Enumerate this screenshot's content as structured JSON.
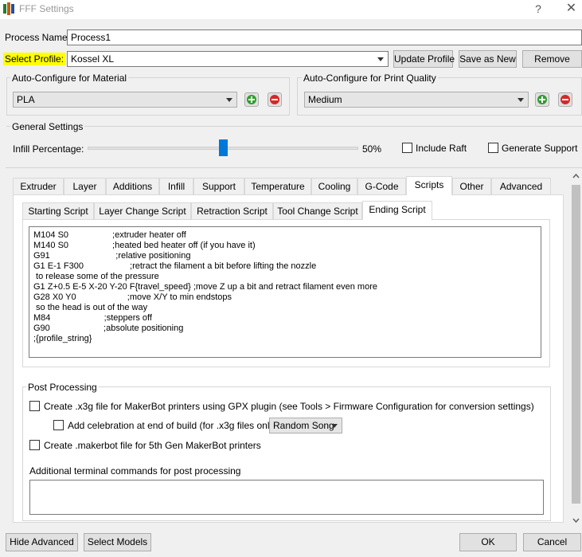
{
  "window": {
    "title": "FFF Settings",
    "help": "?",
    "close": "✕"
  },
  "process": {
    "label": "Process Name:",
    "value": "Process1"
  },
  "profile": {
    "label": "Select Profile:",
    "value": "Kossel XL",
    "buttons": {
      "update": "Update Profile",
      "save_as_new": "Save as New",
      "remove": "Remove"
    }
  },
  "material": {
    "title": "Auto-Configure for Material",
    "value": "PLA"
  },
  "quality": {
    "title": "Auto-Configure for Print Quality",
    "value": "Medium"
  },
  "general": {
    "title": "General Settings",
    "infill_label": "Infill Percentage:",
    "infill_value_text": "50%",
    "infill_fraction": 0.5,
    "include_raft": "Include Raft",
    "generate_support": "Generate Support"
  },
  "tabs": [
    "Extruder",
    "Layer",
    "Additions",
    "Infill",
    "Support",
    "Temperature",
    "Cooling",
    "G-Code",
    "Scripts",
    "Other",
    "Advanced"
  ],
  "active_tab": "Scripts",
  "subtabs": [
    "Starting Script",
    "Layer Change Script",
    "Retraction Script",
    "Tool Change Script",
    "Ending Script"
  ],
  "active_subtab": "Ending Script",
  "ending_script": "M104 S0                  ;extruder heater off\nM140 S0                  ;heated bed heater off (if you have it)\nG91                           ;relative positioning\nG1 E-1 F300                   ;retract the filament a bit before lifting the nozzle\n to release some of the pressure\nG1 Z+0.5 E-5 X-20 Y-20 F{travel_speed} ;move Z up a bit and retract filament even more\nG28 X0 Y0                     ;move X/Y to min endstops\n so the head is out of the way\nM84                      ;steppers off\nG90                      ;absolute positioning\n;{profile_string}",
  "post_processing": {
    "title": "Post Processing",
    "x3g_label": "Create .x3g file for MakerBot printers using GPX plugin (see Tools > Firmware Configuration for conversion settings)",
    "celebration_label": "Add celebration at end of build (for .x3g files only)",
    "celebration_value": "Random Song",
    "makerbot_label": "Create .makerbot file for 5th Gen MakerBot printers",
    "terminal_label": "Additional terminal commands for post processing",
    "terminal_value": ""
  },
  "footer": {
    "hide_advanced": "Hide Advanced",
    "select_models": "Select Models",
    "ok": "OK",
    "cancel": "Cancel"
  },
  "colors": {
    "highlight": "#ffff00",
    "slider_thumb": "#0078d7",
    "add_green": "#2e9e2e",
    "remove_red": "#d42828"
  }
}
